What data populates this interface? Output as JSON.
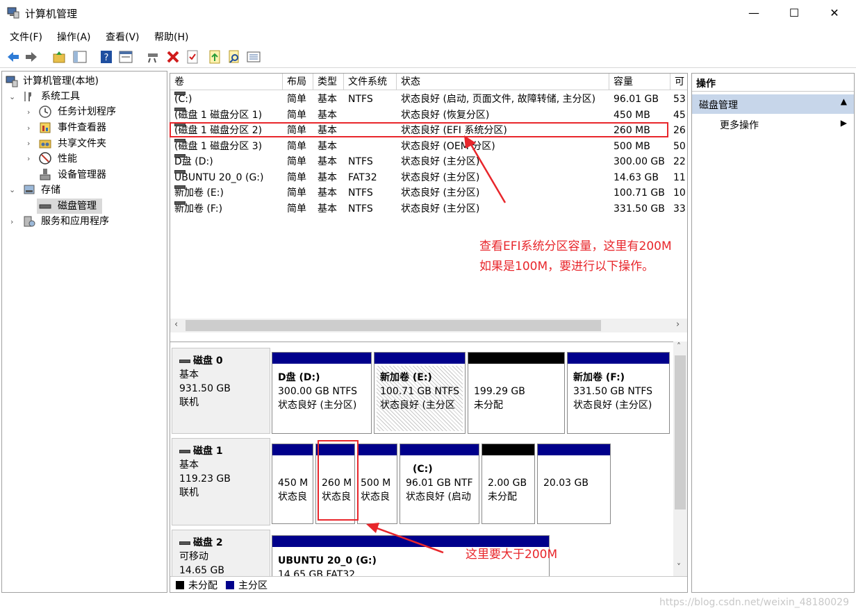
{
  "window": {
    "title": "计算机管理",
    "minimize": "—",
    "maximize": "☐",
    "close": "✕"
  },
  "menu": [
    "文件(F)",
    "操作(A)",
    "查看(V)",
    "帮助(H)"
  ],
  "toolbar": [
    "back-icon",
    "forward-icon",
    "up-folder-icon",
    "show-tree-icon",
    "help-icon",
    "properties-icon",
    "connect-icon",
    "delete-icon",
    "checklist-icon",
    "export-icon",
    "search-icon",
    "list-icon"
  ],
  "tree": {
    "root": "计算机管理(本地)",
    "system_tools": "系统工具",
    "task_scheduler": "任务计划程序",
    "event_viewer": "事件查看器",
    "shared_folders": "共享文件夹",
    "performance": "性能",
    "device_manager": "设备管理器",
    "storage": "存储",
    "disk_management": "磁盘管理",
    "services": "服务和应用程序"
  },
  "volume_table": {
    "headers": [
      "卷",
      "布局",
      "类型",
      "文件系统",
      "状态",
      "容量",
      "可"
    ],
    "rows": [
      [
        "(C:)",
        "简单",
        "基本",
        "NTFS",
        "状态良好 (启动, 页面文件, 故障转储, 主分区)",
        "96.01 GB",
        "53"
      ],
      [
        "(磁盘 1 磁盘分区 1)",
        "简单",
        "基本",
        "",
        "状态良好 (恢复分区)",
        "450 MB",
        "45"
      ],
      [
        "(磁盘 1 磁盘分区 2)",
        "简单",
        "基本",
        "",
        "状态良好 (EFI 系统分区)",
        "260 MB",
        "26"
      ],
      [
        "(磁盘 1 磁盘分区 3)",
        "简单",
        "基本",
        "",
        "状态良好 (OEM 分区)",
        "500 MB",
        "50"
      ],
      [
        "D盘 (D:)",
        "简单",
        "基本",
        "NTFS",
        "状态良好 (主分区)",
        "300.00 GB",
        "22"
      ],
      [
        "UBUNTU 20_0 (G:)",
        "简单",
        "基本",
        "FAT32",
        "状态良好 (主分区)",
        "14.63 GB",
        "11"
      ],
      [
        "新加卷 (E:)",
        "简单",
        "基本",
        "NTFS",
        "状态良好 (主分区)",
        "100.71 GB",
        "10"
      ],
      [
        "新加卷 (F:)",
        "简单",
        "基本",
        "NTFS",
        "状态良好 (主分区)",
        "331.50 GB",
        "33"
      ]
    ]
  },
  "disks": [
    {
      "name": "磁盘 0",
      "type": "基本",
      "size": "931.50 GB",
      "state": "联机",
      "parts": [
        {
          "title": "D盘  (D:)",
          "line1": "300.00 GB NTFS",
          "line2": "状态良好 (主分区)"
        },
        {
          "title": "新加卷  (E:)",
          "line1": "100.71 GB NTFS",
          "line2": "状态良好 (主分区"
        },
        {
          "title": "",
          "line1": "199.29 GB",
          "line2": "未分配"
        },
        {
          "title": "新加卷  (F:)",
          "line1": "331.50 GB NTFS",
          "line2": "状态良好 (主分区)"
        }
      ]
    },
    {
      "name": "磁盘 1",
      "type": "基本",
      "size": "119.23 GB",
      "state": "联机",
      "parts": [
        {
          "title": "",
          "line1": "450 M",
          "line2": "状态良"
        },
        {
          "title": "",
          "line1": "260 M",
          "line2": "状态良"
        },
        {
          "title": "",
          "line1": "500 M",
          "line2": "状态良"
        },
        {
          "title": "(C:)",
          "line1": "96.01 GB NTF",
          "line2": "状态良好 (启动"
        },
        {
          "title": "",
          "line1": "2.00 GB",
          "line2": "未分配"
        },
        {
          "title": "",
          "line1": "20.03 GB",
          "line2": ""
        }
      ]
    },
    {
      "name": "磁盘 2",
      "type": "可移动",
      "size": "14.65 GB",
      "state": "",
      "parts": [
        {
          "title": "UBUNTU 20_0  (G:)",
          "line1": "14.65 GB FAT32",
          "line2": ""
        }
      ]
    }
  ],
  "legend": {
    "unallocated": "未分配",
    "primary": "主分区"
  },
  "actions": {
    "header": "操作",
    "section": "磁盘管理",
    "more": "更多操作"
  },
  "annotations": {
    "note1_line1": "查看EFI系统分区容量，这里有200M",
    "note1_line2": "如果是100M，要进行以下操作。",
    "note2": "这里要大于200M"
  },
  "watermark": "https://blog.csdn.net/weixin_48180029",
  "colors": {
    "annotation": "#e8262b",
    "primary_bar": "#00008b",
    "unallocated_bar": "#000000"
  }
}
